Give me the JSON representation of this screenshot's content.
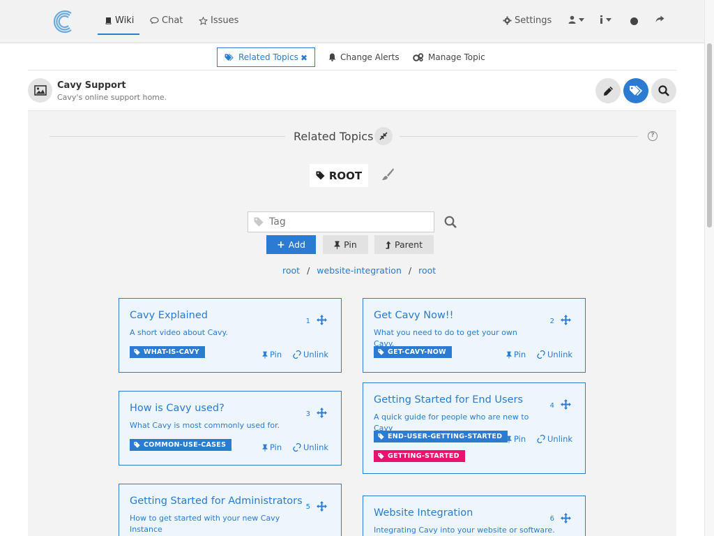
{
  "navbar": {
    "tabs": [
      {
        "label": "Wiki",
        "icon": "book-icon"
      },
      {
        "label": "Chat",
        "icon": "comment-icon"
      },
      {
        "label": "Issues",
        "icon": "star-icon"
      }
    ],
    "settings_label": "Settings",
    "user_icon": "user-icon",
    "info_icon": "info-icon",
    "share_icon": "share-icon"
  },
  "subbar": {
    "related_topics": "Related Topics",
    "change_alerts": "Change Alerts",
    "manage_topic": "Manage Topic"
  },
  "header": {
    "title": "Cavy Support",
    "subtitle": "Cavy's online support home."
  },
  "related": {
    "title": "Related Topics",
    "root_label": "ROOT",
    "tag_placeholder": "Tag",
    "add_label": "Add",
    "pin_label": "Pin",
    "parent_label": "Parent",
    "breadcrumb": [
      "root",
      "website-integration",
      "root"
    ]
  },
  "cards": [
    {
      "num": "1",
      "title": "Cavy Explained",
      "desc": "A short video about Cavy.",
      "tags": [
        {
          "label": "WHAT-IS-CAVY",
          "color": "#2a7bd1"
        }
      ],
      "pin": "Pin",
      "unlink": "Unlink"
    },
    {
      "num": "2",
      "title": "Get Cavy Now!!",
      "desc": "What you need to do to get your own Cavy.",
      "tags": [
        {
          "label": "GET-CAVY-NOW",
          "color": "#2a7bd1"
        }
      ],
      "pin": "Pin",
      "unlink": "Unlink"
    },
    {
      "num": "3",
      "title": "How is Cavy used?",
      "desc": "What Cavy is most commonly used for.",
      "tags": [
        {
          "label": "COMMON-USE-CASES",
          "color": "#2a7bd1"
        }
      ],
      "pin": "Pin",
      "unlink": "Unlink"
    },
    {
      "num": "4",
      "title": "Getting Started for End Users",
      "desc": "A quick guide for people who are new to Cavy",
      "tags": [
        {
          "label": "END-USER-GETTING-STARTED",
          "color": "#2a7bd1"
        },
        {
          "label": "GETTING-STARTED",
          "color": "#e8136e"
        }
      ],
      "pin": "Pin",
      "unlink": "Unlink"
    },
    {
      "num": "5",
      "title": "Getting Started for Administrators",
      "desc": "How to get started with your new Cavy Instance"
    },
    {
      "num": "6",
      "title": "Website Integration",
      "desc": "Integrating Cavy into your website or software."
    }
  ],
  "colors": {
    "accent": "#2a7bd1",
    "pink": "#e8136e",
    "card_bg": "#eef6fd"
  }
}
